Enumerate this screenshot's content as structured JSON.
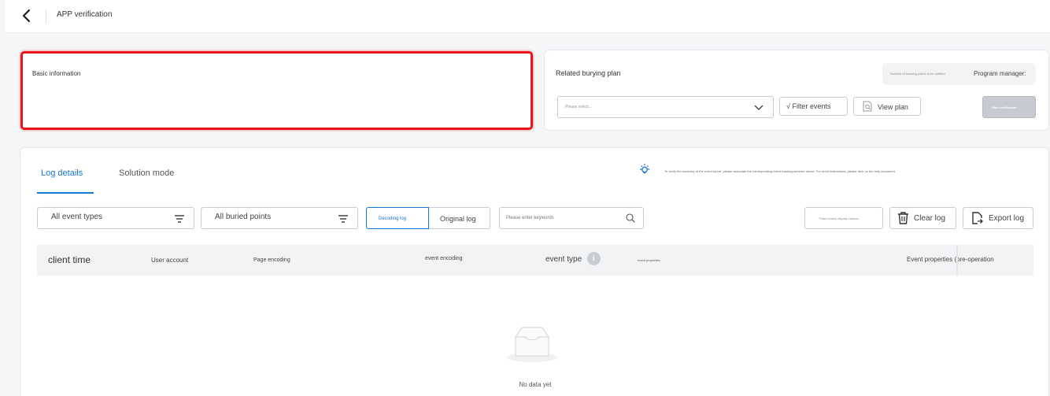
{
  "header": {
    "title": "APP verification"
  },
  "basic_info": {
    "label": "Basic information"
  },
  "plan": {
    "label": "Related burying plan",
    "count_label": "Number of tracking points to be verified",
    "program_manager_label": "Program manager:",
    "select_placeholder": "Please select...",
    "filter_events_label": "√ Filter events",
    "view_plan_label": "View plan",
    "start_verification_label": "Start verification"
  },
  "log": {
    "tabs": [
      {
        "label": "Log details",
        "active": true
      },
      {
        "label": "Solution mode",
        "active": false
      }
    ],
    "tip": "To verify the accuracy of the event report, please associate the corresponding event tracking scheme above. For more instructions, please click on the help document.",
    "filters": {
      "event_types": "All event types",
      "buried_points": "All buried points",
      "decoding_log": "Decoding log",
      "original_log": "Original log",
      "keyword_placeholder": "Please enter keywords",
      "choice_columns": "Three choice display column",
      "clear_log": "Clear log",
      "export_log": "Export log"
    },
    "columns": {
      "client_time": "client time",
      "user_account": "User account",
      "page_encoding": "Page encoding",
      "event_encoding": "event encoding",
      "event_type": "event type",
      "event_properties": "event properties",
      "event_properties_pre": "Event properties (pre-operation"
    },
    "empty": "No data yet"
  },
  "colors": {
    "accent": "#1677d2",
    "highlight": "#e8161c"
  }
}
